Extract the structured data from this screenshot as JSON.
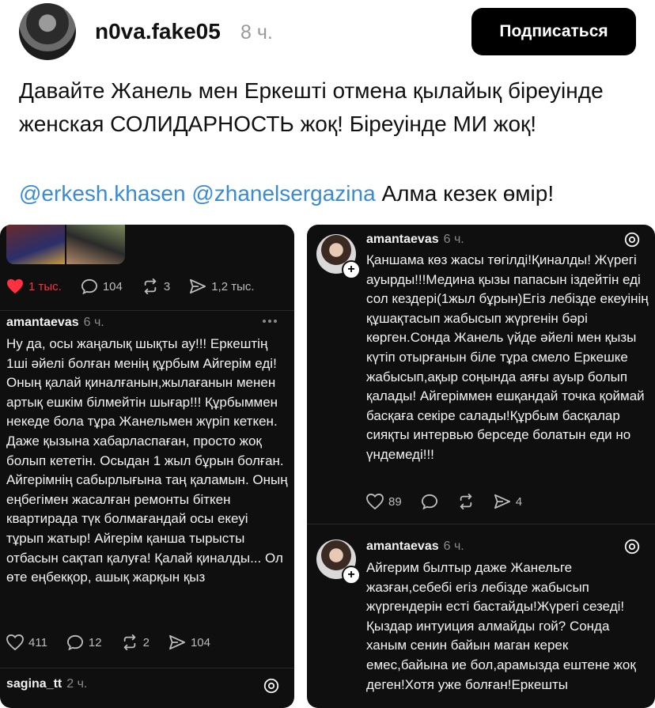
{
  "post": {
    "username": "n0va.fake05",
    "time": "8 ч.",
    "follow_label": "Подписаться",
    "text": "Давайте Жанель мен Еркешті отмена қылайық біреуінде женская СОЛИДАРНОСТЬ жоқ! Біреуінде МИ жоқ!",
    "mention1": "@erkesh.khasen",
    "mention2": "@zhanelsergazina",
    "tags_tail": "Алма кезек өмір!"
  },
  "left_card": {
    "top_actions": {
      "likes": "1 тыс.",
      "comments": "104",
      "reposts": "3",
      "shares": "1,2 тыс."
    },
    "comment": {
      "username": "amantaevas",
      "time": "6 ч.",
      "text": "Ну да, осы жаңалық шықты ау!!! Еркештің 1ші әйелі болған менің құрбым Айгерім еді! Оның қалай қиналғанын,жылағанын менен артық ешкім білмейтін шығар!!! Құрбыммен некеде бола тұра Жанельмен жүріп кеткен. Даже қызына хабарласпаған, просто жоқ болып кететін. Осыдан 1 жыл бұрын болған. Айгерімнің сабырлығына таң қаламын. Оның еңбегімен жасалған ремонты біткен квартирада түк болмағандай осы екеуі тұрып жатыр! Айгерім қанша тырысты отбасын сақтап қалуға! Қалай қиналды... Ол өте еңбекқор, ашық жарқын қыз",
      "actions": {
        "likes": "411",
        "comments": "12",
        "reposts": "2",
        "shares": "104"
      }
    },
    "next_username": "sagina_tt",
    "next_time": "2 ч."
  },
  "right_card": {
    "comment1": {
      "username": "amantaevas",
      "time": "6 ч.",
      "text": "Қаншама көз жасы төгілді!Қиналды! Жүрегі ауырды!!!Медина қызы папасын іздейтін еді сол кездері(1жыл бұрын)Егіз лебізде екеуінің құшақтасып жабысып жүргенін бәрі көрген.Сонда Жанель үйде әйелі мен қызы күтіп отырғанын біле тұра смело Еркешке жабысып,ақыр соңында аяғы ауыр болып қалады! Айгеріммен ешқандай точка қоймай басқаға секіре салады!Құрбым басқалар сияқты интервью берседе болатын еди но үндемеді!!!",
      "actions": {
        "likes": "89",
        "shares": "4"
      }
    },
    "comment2": {
      "username": "amantaevas",
      "time": "6 ч.",
      "text": "Айгерим былтыр даже Жанельге жазған,себебі егіз лебізде жабысып жүргендерін есті бастайды!Жүрегі сезеді!Қыздар интуиция алмайды гой? Сонда ханым сенин байын маган керек емес,байына ие бол,арамызда ештене жоқ деген!Хотя уже болған!Еркешты"
    }
  },
  "colors": {
    "accent": "#3a8bd6",
    "like": "#ff3040",
    "card_bg": "#0f0f0f"
  },
  "icons": [
    "heart-icon",
    "comment-icon",
    "repost-icon",
    "share-icon",
    "more-icon",
    "threads-icon",
    "plus-icon"
  ]
}
